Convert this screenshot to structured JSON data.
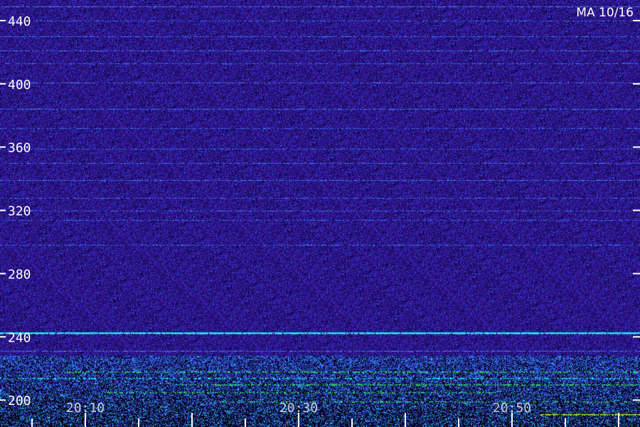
{
  "chart_data": {
    "type": "heatmap",
    "title": "MA 10/16",
    "x_tick_labels": [
      "20:10",
      "20:30",
      "20:50"
    ],
    "x_label_minutes": [
      10,
      30,
      50
    ],
    "x_range_minutes": [
      2,
      62
    ],
    "x_tick_every_minutes": 5,
    "y_ticks": [
      440,
      400,
      360,
      320,
      280,
      240,
      200
    ],
    "y_range": [
      183,
      453
    ],
    "colors": {
      "background_noise": "#2a1796",
      "dark_noise": "#14084a",
      "line_blue": "#2f6cff",
      "strong_cyan": "#19f0f0",
      "green": "#33e05a",
      "yellow": "#c8e62a",
      "axis": "#ffffff"
    },
    "persistent_lines": [
      {
        "y": 449,
        "strength": 0.6
      },
      {
        "y": 440,
        "strength": 0.25
      },
      {
        "y": 430,
        "strength": 0.35
      },
      {
        "y": 421,
        "strength": 0.45
      },
      {
        "y": 413,
        "strength": 0.3
      },
      {
        "y": 401,
        "strength": 0.4
      },
      {
        "y": 384,
        "strength": 0.5
      },
      {
        "y": 372,
        "strength": 0.25
      },
      {
        "y": 359,
        "strength": 0.3
      },
      {
        "y": 350,
        "strength": 0.35
      },
      {
        "y": 339,
        "strength": 0.5
      },
      {
        "y": 328,
        "strength": 0.3
      },
      {
        "y": 320,
        "strength": 0.3
      },
      {
        "y": 314,
        "strength": 0.25
      },
      {
        "y": 298,
        "strength": 0.3
      },
      {
        "y": 243,
        "strength": 1.0
      },
      {
        "y": 231,
        "strength": 0.55
      },
      {
        "y": 226,
        "strength": 0.45
      }
    ]
  }
}
